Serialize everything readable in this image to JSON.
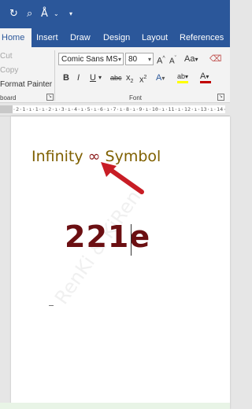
{
  "quick_access": {
    "redo_icon": "redo-icon",
    "search_icon": "search-icon",
    "accessibility_icon": "accessibility-icon"
  },
  "tabs": [
    {
      "label": "Home",
      "active": true
    },
    {
      "label": "Insert",
      "active": false
    },
    {
      "label": "Draw",
      "active": false
    },
    {
      "label": "Design",
      "active": false
    },
    {
      "label": "Layout",
      "active": false
    },
    {
      "label": "References",
      "active": false
    }
  ],
  "clipboard": {
    "cut": "Cut",
    "copy": "Copy",
    "format_painter": "Format Painter",
    "group_label": "board"
  },
  "font": {
    "family": "Comic Sans MS",
    "size": "80",
    "group_label": "Font",
    "grow": "A",
    "shrink": "A",
    "change_case": "Aa",
    "bold": "B",
    "italic": "I",
    "underline": "U",
    "strikethrough": "abc",
    "subscript": "x",
    "superscript": "x",
    "effects": "A",
    "highlight": "ab",
    "font_color": "A"
  },
  "ruler": {
    "text": "·2·1·ı·1·ı·2·ı·3·ı·4·ı·5·ı·6·ı·7·ı·8·ı·9·ı·10·ı·11·ı·12·ı·13·ı·14·ı·15·ı·16·"
  },
  "document": {
    "line1_before": "Infinity ",
    "infinity_symbol": "∞",
    "line1_after": " Symbol",
    "line2": "221e",
    "watermark": "RenKi & KiRen"
  },
  "colors": {
    "ribbon_blue": "#2b579a",
    "title_text": "#7f6000",
    "symbol_code": "#6b0f12",
    "arrow": "#c81d25",
    "highlight_bar": "#ffff00",
    "font_color_bar": "#c00000"
  }
}
